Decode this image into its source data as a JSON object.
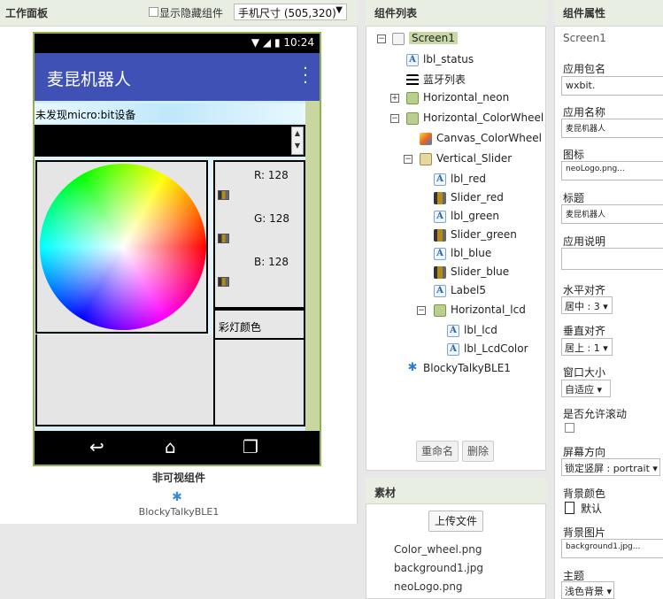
{
  "viewer": {
    "title": "工作面板",
    "show_hidden_label": "显示隐藏组件",
    "size_select": "手机尺寸 (505,320)",
    "size_arrow": "▼",
    "phone": {
      "time": "10:24",
      "app_title": "麦昆机器人",
      "lbl_status_text": "未发现micro:bit设备",
      "r_label": "R: 128",
      "g_label": "G: 128",
      "b_label": "B: 128",
      "lcd_label": "彩灯颜色"
    },
    "nonvisible_title": "非可视组件",
    "nonvisible_name": "BlockyTalkyBLE1"
  },
  "tree": {
    "title": "组件列表",
    "items": [
      {
        "label": "Screen1",
        "icon": "screen-icon"
      },
      {
        "label": "lbl_status",
        "icon": "label-icon"
      },
      {
        "label": "蓝牙列表",
        "icon": "listview-icon"
      },
      {
        "label": "Horizontal_neon",
        "icon": "horizontal-arrangement-icon"
      },
      {
        "label": "Horizontal_ColorWheel",
        "icon": "horizontal-arrangement-icon"
      },
      {
        "label": "Canvas_ColorWheel",
        "icon": "canvas-icon"
      },
      {
        "label": "Vertical_Slider",
        "icon": "vertical-arrangement-icon"
      },
      {
        "label": "lbl_red",
        "icon": "label-icon"
      },
      {
        "label": "Slider_red",
        "icon": "slider-icon"
      },
      {
        "label": "lbl_green",
        "icon": "label-icon"
      },
      {
        "label": "Slider_green",
        "icon": "slider-icon"
      },
      {
        "label": "lbl_blue",
        "icon": "label-icon"
      },
      {
        "label": "Slider_blue",
        "icon": "slider-icon"
      },
      {
        "label": "Label5",
        "icon": "label-icon"
      },
      {
        "label": "Horizontal_lcd",
        "icon": "horizontal-arrangement-icon"
      },
      {
        "label": "lbl_lcd",
        "icon": "label-icon"
      },
      {
        "label": "lbl_LcdColor",
        "icon": "label-icon"
      },
      {
        "label": "BlockyTalkyBLE1",
        "icon": "bluetooth-icon"
      }
    ],
    "rename_label": "重命名",
    "delete_label": "删除"
  },
  "assets": {
    "title": "素材",
    "upload_label": "上传文件",
    "files": [
      "Color_wheel.png",
      "background1.jpg",
      "neoLogo.png"
    ]
  },
  "props": {
    "title": "组件属性",
    "component": "Screen1",
    "package_label": "应用包名",
    "package_value": "wxbit.",
    "app_name_label": "应用名称",
    "app_name_value": "麦昆机器人",
    "icon_label": "图标",
    "icon_value": "neoLogo.png...",
    "title_label": "标题",
    "title_value": "麦昆机器人",
    "about_label": "应用说明",
    "halign_label": "水平对齐",
    "halign_value": "居中 : 3",
    "valign_label": "垂直对齐",
    "valign_value": "居上 : 1",
    "sizing_label": "窗口大小",
    "sizing_value": "自适应",
    "scroll_label": "是否允许滚动",
    "orientation_label": "屏幕方向",
    "orientation_value": "锁定竖屏 : portrait",
    "bgcolor_label": "背景颜色",
    "bgcolor_value": "默认",
    "bgimage_label": "背景图片",
    "bgimage_value": "background1.jpg...",
    "theme_label": "主题",
    "theme_value": "浅色背景"
  },
  "colors": {
    "appbar": "#3f51b5",
    "panel_header": "#e9eee2",
    "selected": "#c8d8a6"
  }
}
